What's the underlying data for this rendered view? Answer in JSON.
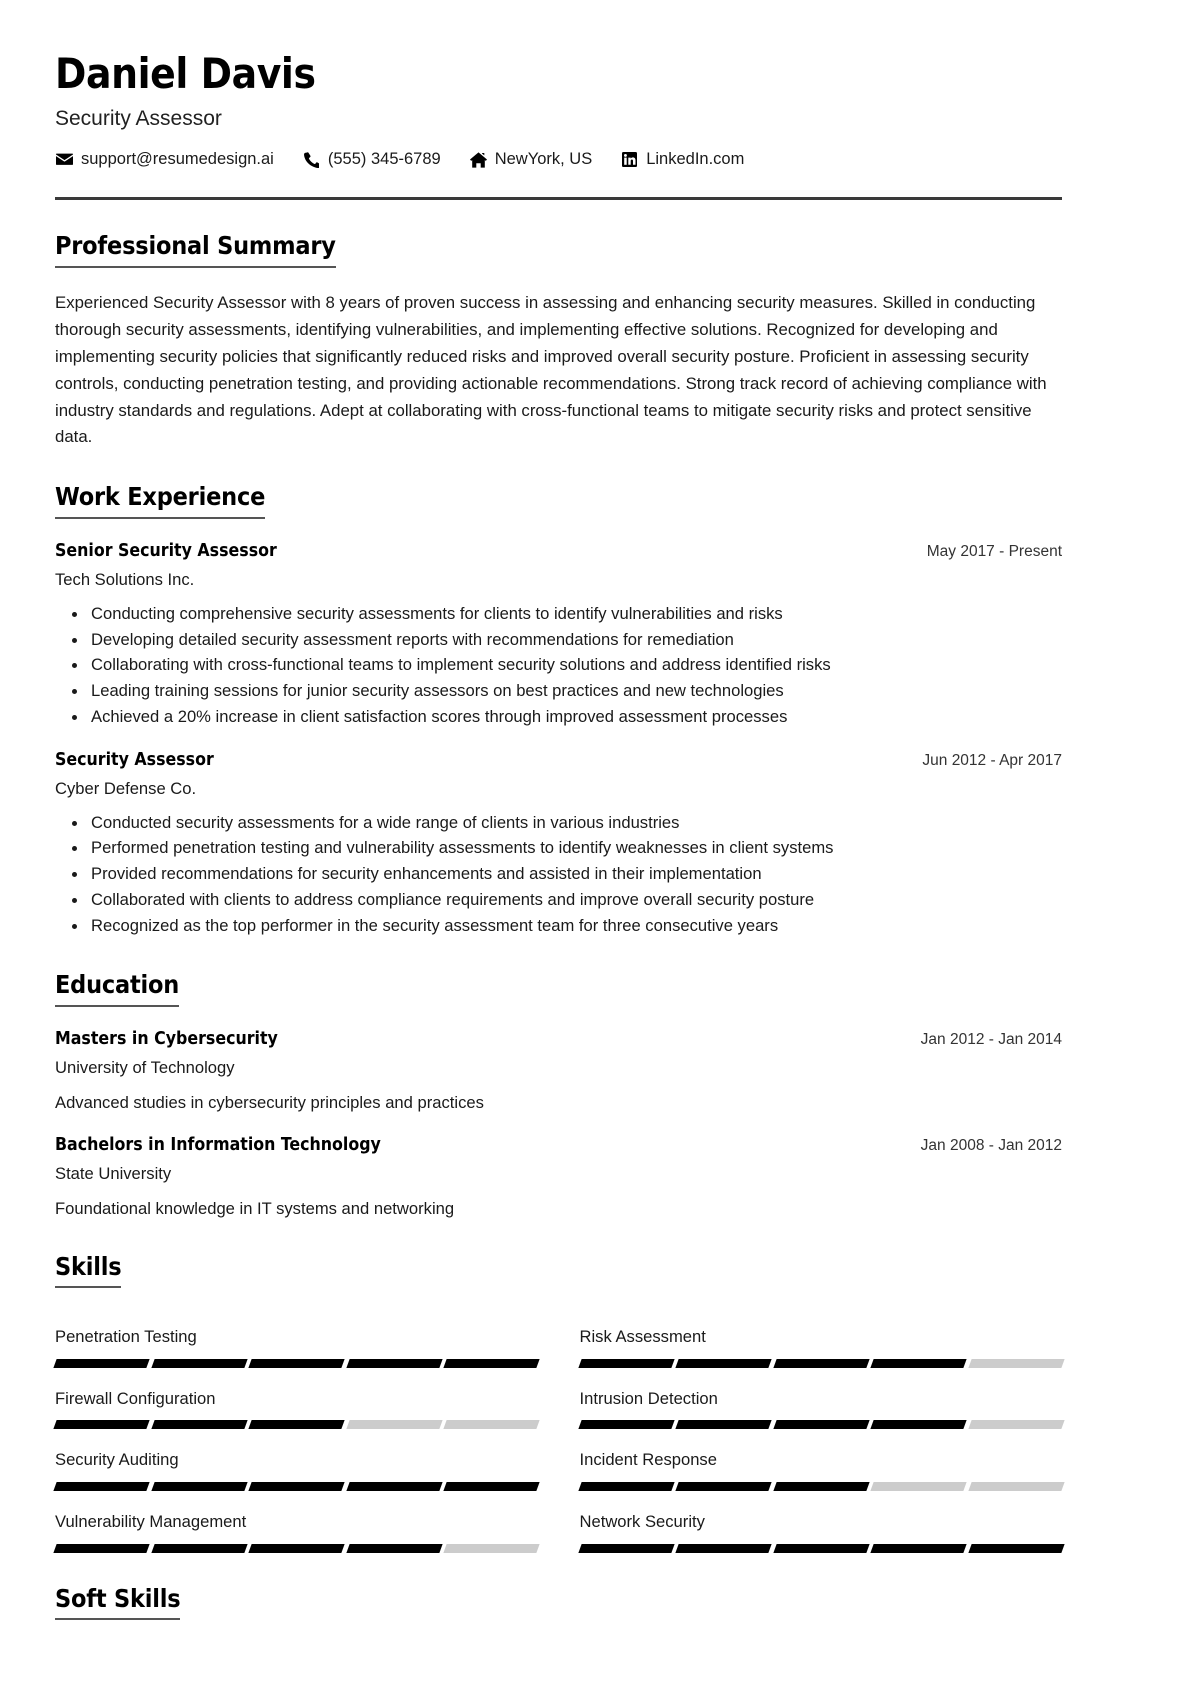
{
  "header": {
    "name": "Daniel Davis",
    "job_title": "Security Assessor",
    "contacts": [
      {
        "icon": "envelope-icon",
        "text": "support@resumedesign.ai"
      },
      {
        "icon": "phone-icon",
        "text": "(555) 345-6789"
      },
      {
        "icon": "home-icon",
        "text": "NewYork, US"
      },
      {
        "icon": "linkedin-icon",
        "text": "LinkedIn.com"
      }
    ]
  },
  "summary": {
    "title": "Professional Summary",
    "text": "Experienced Security Assessor with 8 years of proven success in assessing and enhancing security measures. Skilled in conducting thorough security assessments, identifying vulnerabilities, and implementing effective solutions. Recognized for developing and implementing security policies that significantly reduced risks and improved overall security posture. Proficient in assessing security controls, conducting penetration testing, and providing actionable recommendations. Strong track record of achieving compliance with industry standards and regulations. Adept at collaborating with cross-functional teams to mitigate security risks and protect sensitive data."
  },
  "experience": {
    "title": "Work Experience",
    "entries": [
      {
        "role": "Senior Security Assessor",
        "date": "May 2017 - Present",
        "org": "Tech Solutions Inc.",
        "bullets": [
          "Conducting comprehensive security assessments for clients to identify vulnerabilities and risks",
          "Developing detailed security assessment reports with recommendations for remediation",
          "Collaborating with cross-functional teams to implement security solutions and address identified risks",
          "Leading training sessions for junior security assessors on best practices and new technologies",
          "Achieved a 20% increase in client satisfaction scores through improved assessment processes"
        ]
      },
      {
        "role": "Security Assessor",
        "date": "Jun 2012 - Apr 2017",
        "org": "Cyber Defense Co.",
        "bullets": [
          "Conducted security assessments for a wide range of clients in various industries",
          "Performed penetration testing and vulnerability assessments to identify weaknesses in client systems",
          "Provided recommendations for security enhancements and assisted in their implementation",
          "Collaborated with clients to address compliance requirements and improve overall security posture",
          "Recognized as the top performer in the security assessment team for three consecutive years"
        ]
      }
    ]
  },
  "education": {
    "title": "Education",
    "entries": [
      {
        "degree": "Masters in Cybersecurity",
        "date": "Jan 2012 - Jan 2014",
        "school": "University of Technology",
        "description": "Advanced studies in cybersecurity principles and practices"
      },
      {
        "degree": "Bachelors in Information Technology",
        "date": "Jan 2008 - Jan 2012",
        "school": "State University",
        "description": "Foundational knowledge in IT systems and networking"
      }
    ]
  },
  "skills": {
    "title": "Skills",
    "max_level": 5,
    "items": [
      {
        "name": "Penetration Testing",
        "level": 5
      },
      {
        "name": "Risk Assessment",
        "level": 4
      },
      {
        "name": "Firewall Configuration",
        "level": 3
      },
      {
        "name": "Intrusion Detection",
        "level": 4
      },
      {
        "name": "Security Auditing",
        "level": 5
      },
      {
        "name": "Incident Response",
        "level": 3
      },
      {
        "name": "Vulnerability Management",
        "level": 4
      },
      {
        "name": "Network Security",
        "level": 5
      }
    ]
  },
  "soft_skills": {
    "title": "Soft Skills"
  },
  "colors": {
    "filled_segment": "#000000",
    "empty_segment": "#cccccc",
    "rule": "#3a3a3a",
    "text": "#1a1a1a"
  }
}
